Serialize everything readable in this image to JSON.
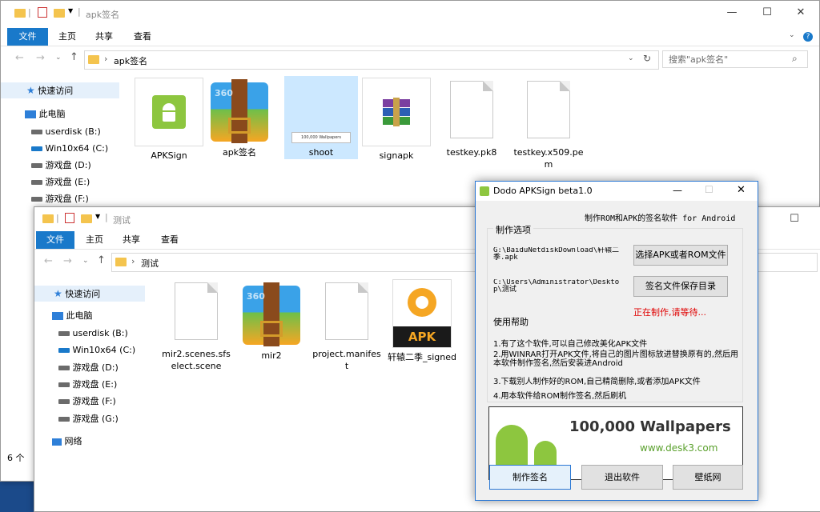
{
  "win1": {
    "title": "apk签名",
    "ribbon": {
      "file": "文件",
      "home": "主页",
      "share": "共享",
      "view": "查看"
    },
    "address": "apk签名",
    "search_placeholder": "搜索\"apk签名\"",
    "nav": {
      "quick": "快速访问",
      "pc": "此电脑",
      "drives": [
        "userdisk (B:)",
        "Win10x64 (C:)",
        "游戏盘 (D:)",
        "游戏盘 (E:)",
        "游戏盘 (F:)"
      ]
    },
    "files": [
      "APKSign",
      "apk签名",
      "shoot",
      "signapk",
      "testkey.pk8",
      "testkey.x509.pem"
    ],
    "status": "6 个"
  },
  "win2": {
    "title": "测试",
    "ribbon": {
      "file": "文件",
      "home": "主页",
      "share": "共享",
      "view": "查看"
    },
    "address": "测试",
    "nav": {
      "quick": "快速访问",
      "pc": "此电脑",
      "drives": [
        "userdisk (B:)",
        "Win10x64 (C:)",
        "游戏盘 (D:)",
        "游戏盘 (E:)",
        "游戏盘 (F:)",
        "游戏盘 (G:)"
      ],
      "network": "网络"
    },
    "files": [
      "mir2.scenes.sfselect.scene",
      "mir2",
      "project.manifest",
      "轩辕二季_signed"
    ]
  },
  "dialog": {
    "title": "Dodo APKSign beta1.0",
    "subtitle": "制作ROM和APK的签名软件 for Android",
    "group_label": "制作选项",
    "path1": "G:\\BaiduNetdiskDownload\\轩辕二季.apk",
    "path2": "C:\\Users\\Administrator\\Desktop\\测试",
    "btn_choose": "选择APK或者ROM文件",
    "btn_save_dir": "签名文件保存目录",
    "status": "正在制作,请等待...",
    "help_label": "使用帮助",
    "help": [
      "1.有了这个软件,可以自己修改美化APK文件",
      "2.用WINRAR打开APK文件,将自己的图片图标放进替换原有的,然后用本软件制作签名,然后安装进Android",
      "3.下载别人制作好的ROM,自己精简删除,或者添加APK文件",
      "4.用本软件给ROM制作签名,然后刷机"
    ],
    "banner_text": "100,000 Wallpapers",
    "banner_url": "www.desk3.com",
    "btn_make": "制作签名",
    "btn_exit": "退出软件",
    "btn_wallpaper": "壁纸网"
  },
  "thumb_text": "100,000 Wallpapers",
  "apk_badge": "APK",
  "zip_text": "360\nZIP",
  "colors": {
    "accent": "#1979ca",
    "status_red": "#e00000",
    "android_green": "#8dc63f"
  }
}
